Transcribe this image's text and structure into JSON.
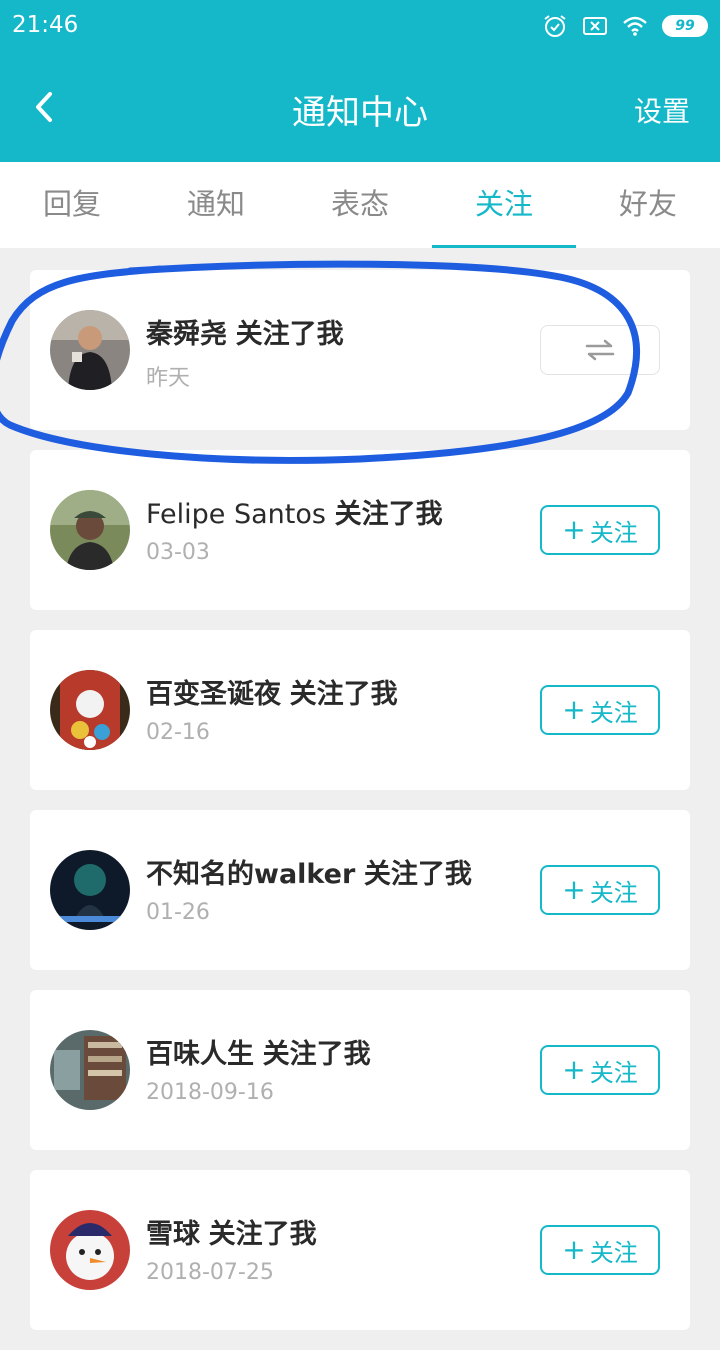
{
  "status_bar": {
    "time": "21:46",
    "battery": "99"
  },
  "header": {
    "title": "通知中心",
    "settings_label": "设置"
  },
  "tabs": [
    {
      "label": "回复",
      "active": false
    },
    {
      "label": "通知",
      "active": false
    },
    {
      "label": "表态",
      "active": false
    },
    {
      "label": "关注",
      "active": true
    },
    {
      "label": "好友",
      "active": false
    }
  ],
  "follow_label": "关注",
  "items": [
    {
      "user": "秦舜尧",
      "action": "关注了我",
      "date": "昨天",
      "mutual": true
    },
    {
      "user": "Felipe Santos",
      "action": "关注了我",
      "date": "03-03",
      "mutual": false
    },
    {
      "user": "百变圣诞夜",
      "action": "关注了我",
      "date": "02-16",
      "mutual": false
    },
    {
      "user": "不知名的walker",
      "action": "关注了我",
      "date": "01-26",
      "mutual": false
    },
    {
      "user": "百味人生",
      "action": "关注了我",
      "date": "2018-09-16",
      "mutual": false
    },
    {
      "user": "雪球",
      "action": "关注了我",
      "date": "2018-07-25",
      "mutual": false
    }
  ],
  "colors": {
    "accent": "#14b8c8",
    "annotation": "#1f5de0"
  }
}
